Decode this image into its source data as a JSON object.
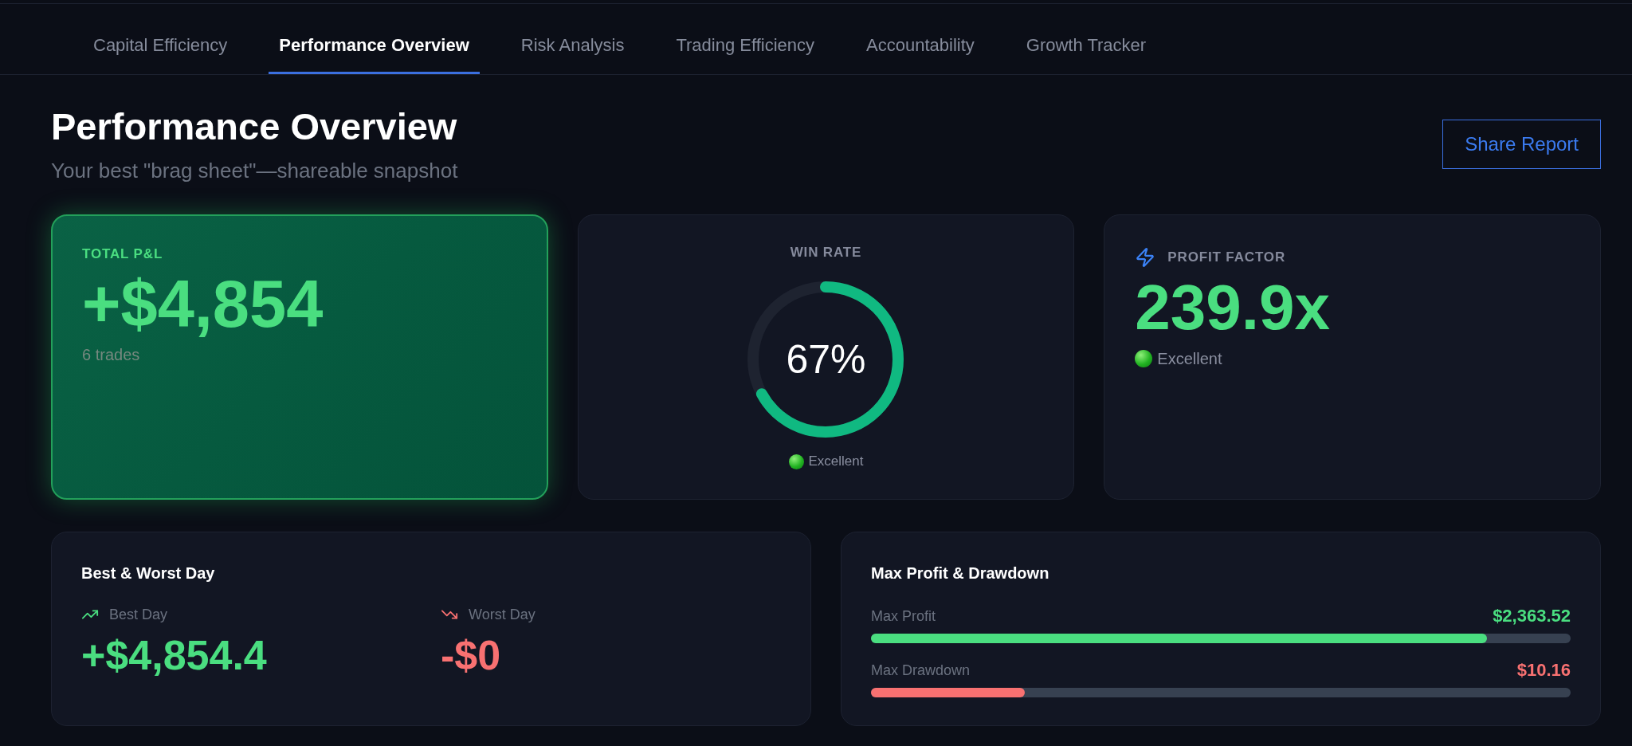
{
  "tabs": [
    {
      "label": "Capital Efficiency",
      "selected": false
    },
    {
      "label": "Performance Overview",
      "selected": true
    },
    {
      "label": "Risk Analysis",
      "selected": false
    },
    {
      "label": "Trading Efficiency",
      "selected": false
    },
    {
      "label": "Accountability",
      "selected": false
    },
    {
      "label": "Growth Tracker",
      "selected": false
    }
  ],
  "header": {
    "title": "Performance Overview",
    "subtitle": "Your best \"brag sheet\"—shareable snapshot",
    "share_button": "Share Report"
  },
  "total_pnl": {
    "label": "TOTAL P&L",
    "value": "+$4,854",
    "note": "6 trades"
  },
  "win_rate": {
    "label": "WIN RATE",
    "level": 0.67,
    "reading": "67%",
    "rating": "Excellent"
  },
  "profit_factor": {
    "label": "PROFIT FACTOR",
    "value": "239.9x",
    "rating": "Excellent"
  },
  "best_worst_day": {
    "title": "Best & Worst Day",
    "items": [
      {
        "kind": "gain",
        "label": "Best Day",
        "value": "+$4,854.4"
      },
      {
        "kind": "loss",
        "label": "Worst Day",
        "value": "-$0"
      }
    ]
  },
  "max_profit_drawdown": {
    "title": "Max Profit & Drawdown",
    "bars": [
      {
        "kind": "profit",
        "label": "Max Profit",
        "value": "$2,363.52",
        "level": 0.88
      },
      {
        "kind": "drawdown",
        "label": "Max Drawdown",
        "value": "$10.16",
        "level": 0.22
      }
    ]
  }
}
